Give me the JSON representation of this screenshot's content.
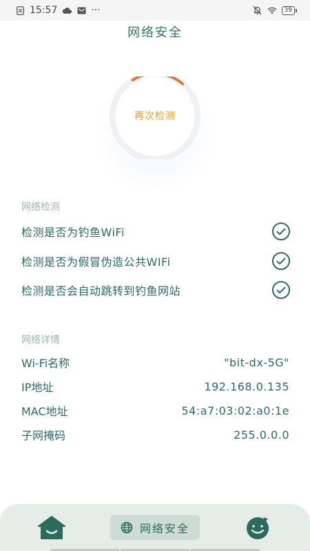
{
  "status_bar": {
    "time": "15:57",
    "dots": "···",
    "battery": "39"
  },
  "page": {
    "title": "网络安全"
  },
  "scan": {
    "button_label": "再次检测",
    "progress": 0.2
  },
  "network_check": {
    "label": "网络检测",
    "items": [
      {
        "text": "检测是否为钓鱼WiFi",
        "status": "passed"
      },
      {
        "text": "检测是否为假冒伪造公共WIFi",
        "status": "passed"
      },
      {
        "text": "检测是否会自动跳转到钓鱼网站",
        "status": "passed"
      }
    ]
  },
  "network_details": {
    "label": "网络详情",
    "rows": [
      {
        "key": "Wi-Fi名称",
        "value": "\"bit-dx-5G\""
      },
      {
        "key": "IP地址",
        "value": "192.168.0.135"
      },
      {
        "key": "MAC地址",
        "value": "54:a7:03:02:a0:1e"
      },
      {
        "key": "子网掩码",
        "value": "255.0.0.0"
      }
    ]
  },
  "bottom_nav": {
    "active_label": "网络安全"
  },
  "colors": {
    "primary": "#2d6a5c",
    "accent": "#e3a23a",
    "ring_arc": "#e07a3a",
    "nav_bg": "#e6ece8"
  },
  "icons": {
    "check": "check-circle-icon",
    "home": "home-icon",
    "globe": "globe-icon",
    "face": "smile-face-icon"
  }
}
